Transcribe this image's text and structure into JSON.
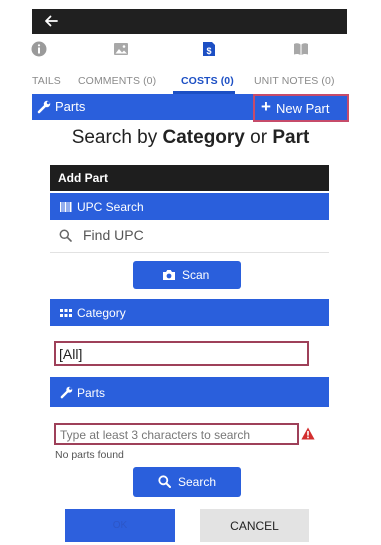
{
  "top_screen": {
    "tabs": [
      {
        "label": "TAILS",
        "icon": "info-icon",
        "active": false
      },
      {
        "label": "COMMENTS (0)",
        "icon": "image-icon",
        "active": false
      },
      {
        "label": "COSTS (0)",
        "icon": "dollar-document-icon",
        "active": true
      },
      {
        "label": "UNIT NOTES (0)",
        "icon": "book-icon",
        "active": false
      }
    ],
    "parts_label": "Parts",
    "new_part_plus": "+",
    "new_part_label": "New Part"
  },
  "caption": {
    "prefix": "Search by ",
    "bold1": "Category",
    "middle": " or ",
    "bold2": "Part"
  },
  "dialog": {
    "title": "Add Part",
    "upc_header": "UPC Search",
    "upc_placeholder": "Find UPC",
    "scan_label": "Scan",
    "category_header": "Category",
    "category_value": "[All]",
    "parts_header": "Parts",
    "parts_placeholder": "Type at least 3 characters to search",
    "no_parts_text": "No parts found",
    "search_label": "Search",
    "ok_label": "OK",
    "cancel_label": "CANCEL"
  },
  "colors": {
    "accent_blue": "#2a5fdc",
    "active_tab": "#1c4fc4",
    "highlight_border": "#c64b6a",
    "warning": "#d32f2f",
    "title_bar": "#1e1e1e"
  }
}
